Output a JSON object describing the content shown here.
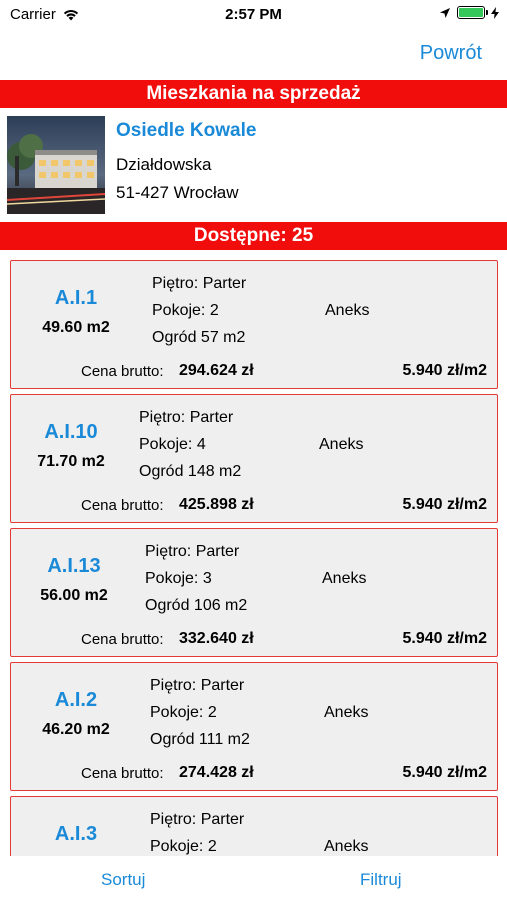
{
  "status_bar": {
    "carrier": "Carrier",
    "time": "2:57 PM",
    "icons": [
      "wifi-icon",
      "location-arrow-icon",
      "battery-icon"
    ]
  },
  "nav": {
    "back_label": "Powrót"
  },
  "header": {
    "title": "Mieszkania na sprzedaż"
  },
  "estate": {
    "name": "Osiedle Kowale",
    "street": "Działdowska",
    "city": "51-427 Wrocław"
  },
  "available": {
    "label": "Dostępne: 25"
  },
  "price_label": "Cena brutto:",
  "apartments": [
    {
      "id": "A.I.1",
      "area": "49.60 m2",
      "floor": "Piętro: Parter",
      "rooms": "Pokoje: 2",
      "garden": "Ogród 57 m2",
      "kitchen": "Aneks",
      "price": "294.624 zł",
      "price_m2": "5.940 zł/m2"
    },
    {
      "id": "A.I.10",
      "area": "71.70 m2",
      "floor": "Piętro: Parter",
      "rooms": "Pokoje: 4",
      "garden": "Ogród 148 m2",
      "kitchen": "Aneks",
      "price": "425.898 zł",
      "price_m2": "5.940 zł/m2"
    },
    {
      "id": "A.I.13",
      "area": "56.00 m2",
      "floor": "Piętro: Parter",
      "rooms": "Pokoje: 3",
      "garden": "Ogród 106 m2",
      "kitchen": "Aneks",
      "price": "332.640 zł",
      "price_m2": "5.940 zł/m2"
    },
    {
      "id": "A.I.2",
      "area": "46.20 m2",
      "floor": "Piętro: Parter",
      "rooms": "Pokoje: 2",
      "garden": "Ogród 111 m2",
      "kitchen": "Aneks",
      "price": "274.428 zł",
      "price_m2": "5.940 zł/m2"
    },
    {
      "id": "A.I.3",
      "area": "",
      "floor": "Piętro: Parter",
      "rooms": "Pokoje: 2",
      "garden": "",
      "kitchen": "Aneks",
      "price": "",
      "price_m2": ""
    }
  ],
  "toolbar": {
    "sort_label": "Sortuj",
    "filter_label": "Filtruj"
  },
  "colors": {
    "accent": "#1a8ad8",
    "header_red": "#f20d0d",
    "card_border": "#e53935",
    "card_bg": "#efefef"
  }
}
